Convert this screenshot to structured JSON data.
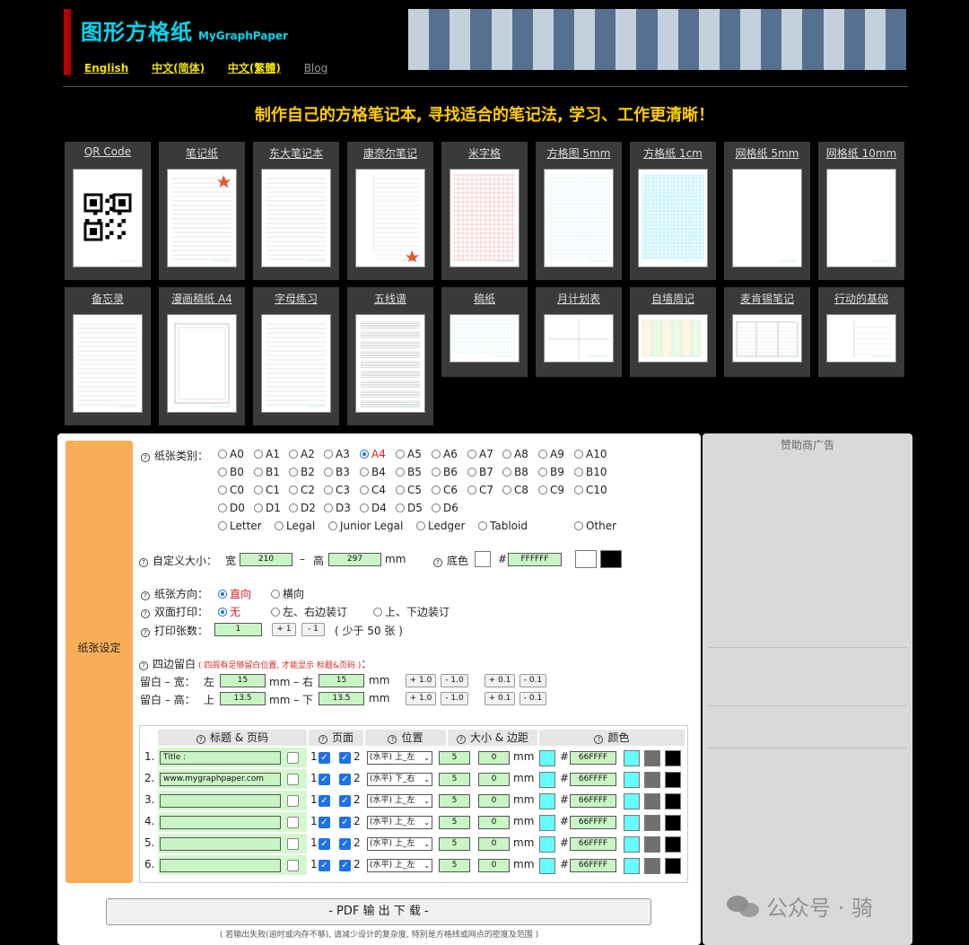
{
  "header": {
    "title": "图形方格纸",
    "subtitle": "MyGraphPaper",
    "langs": [
      "English",
      "中文(简体)",
      "中文(繁體)",
      "Blog"
    ],
    "tagline": "制作自己的方格笔记本, 寻找适合的笔记法, 学习、工作更清晰！"
  },
  "cards": [
    "QR Code",
    "笔记纸",
    "东大笔记本",
    "康奈尔笔记",
    "米字格",
    "方格图 5mm",
    "方格纸 1cm",
    "网格纸 5mm",
    "网格纸 10mm",
    "备忘录",
    "漫画稿纸 A4",
    "字母练习",
    "五线谱",
    "稿纸",
    "月计划表",
    "自墙周记",
    "麦肯锡笔记",
    "行动的基础"
  ],
  "settings": {
    "tab": "纸张设定",
    "paper_type_label": "纸张类别：",
    "sizes": [
      [
        "A0",
        "A1",
        "A2",
        "A3",
        "A4",
        "A5",
        "A6",
        "A7",
        "A8",
        "A9",
        "A10"
      ],
      [
        "B0",
        "B1",
        "B2",
        "B3",
        "B4",
        "B5",
        "B6",
        "B7",
        "B8",
        "B9",
        "B10"
      ],
      [
        "C0",
        "C1",
        "C2",
        "C3",
        "C4",
        "C5",
        "C6",
        "C7",
        "C8",
        "C9",
        "C10"
      ],
      [
        "D0",
        "D1",
        "D2",
        "D3",
        "D4",
        "D5",
        "D6"
      ],
      [
        "Letter",
        "Legal",
        "Junior Legal",
        "Ledger",
        "Tabloid",
        "Other"
      ]
    ],
    "selected_size": "A4",
    "custom_label": "自定义大小：",
    "width_label": "宽",
    "width": "210",
    "dash": "–",
    "height_label": "高",
    "height": "297",
    "mm": "mm",
    "bg_label": "底色",
    "hash": "#",
    "bg_value": "FFFFFF",
    "orient_label": "纸张方向：",
    "portrait": "直向",
    "landscape": "横向",
    "duplex_label": "双面打印：",
    "duplex_none": "无",
    "duplex_lr": "左、右边装订",
    "duplex_tb": "上、下边装订",
    "count_label": "打印张数：",
    "count": "1",
    "plus1": "+ 1",
    "minus1": "- 1",
    "count_note": "( 少于 50 张 )",
    "margin_label": "四边留白",
    "margin_note": "( 四周有足够留白位置, 才能显示 标题&页码 )",
    "colon": "：",
    "mw_label": "留白 – 宽：",
    "left_label": "左",
    "left": "15",
    "mm_dash_right": "mm – 右",
    "right": "15",
    "mh_label": "留白 – 高：",
    "top_label": "上",
    "top": "13.5",
    "mm_dash_bottom": "mm – 下",
    "bottom": "13.5",
    "b_p1": "+ 1.0",
    "b_m1": "- 1.0",
    "b_p01": "+ 0.1",
    "b_m01": "- 0.1"
  },
  "table": {
    "headers": [
      "标题 & 页码",
      "页面",
      "位置",
      "大小 & 边距",
      "颜色"
    ],
    "rows": [
      {
        "n": "1.",
        "text": "Title :",
        "pos": "(水平) 上_左",
        "size": "5",
        "margin": "0",
        "color": "66FFFF"
      },
      {
        "n": "2.",
        "text": "www.mygraphpaper.com",
        "pos": "(水平) 下_右",
        "size": "5",
        "margin": "0",
        "color": "66FFFF"
      },
      {
        "n": "3.",
        "text": "",
        "pos": "(水平) 上_左",
        "size": "5",
        "margin": "0",
        "color": "66FFFF"
      },
      {
        "n": "4.",
        "text": "",
        "pos": "(水平) 上_左",
        "size": "5",
        "margin": "0",
        "color": "66FFFF"
      },
      {
        "n": "5.",
        "text": "",
        "pos": "(水平) 上_左",
        "size": "5",
        "margin": "0",
        "color": "66FFFF"
      },
      {
        "n": "6.",
        "text": "",
        "pos": "(水平) 上_左",
        "size": "5",
        "margin": "0",
        "color": "66FFFF"
      }
    ],
    "p1": "1",
    "p2": "2",
    "mm": "mm",
    "hash": "#"
  },
  "pdf_button": "- PDF 输 出 下 载 -",
  "pdf_note": "( 若输出失败(逾时或内存不够), 请减少设计的复杂度, 特别是方格线或网点的密度及范围 )",
  "ad_title": "赞助商广告",
  "watermark": "公众号 · 骑",
  "colors": {
    "accent_cyan": "#00d8f0",
    "gold": "#ffcc00",
    "tab_orange": "#f9ad57",
    "input_green": "#c9f5c4",
    "swatch_cyan": "#66ffff"
  }
}
